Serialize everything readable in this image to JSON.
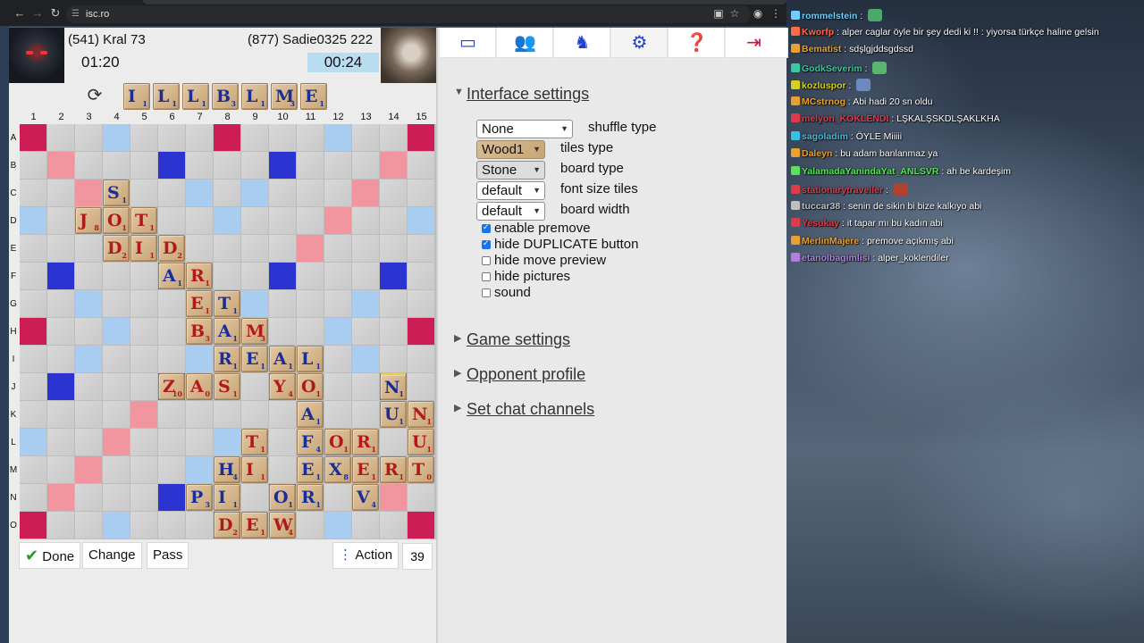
{
  "browser": {
    "url": "isc.ro"
  },
  "players": {
    "me": {
      "name": "(541) Kral 73",
      "time": "01:20"
    },
    "opponent": {
      "name": "(877) Sadie0325 222",
      "time": "00:24"
    }
  },
  "rack": [
    {
      "l": "I",
      "v": "1"
    },
    {
      "l": "L",
      "v": "1"
    },
    {
      "l": "L",
      "v": "1"
    },
    {
      "l": "B",
      "v": "3"
    },
    {
      "l": "L",
      "v": "1"
    },
    {
      "l": "M",
      "v": "3"
    },
    {
      "l": "E",
      "v": "1"
    }
  ],
  "columns": [
    "1",
    "2",
    "3",
    "4",
    "5",
    "6",
    "7",
    "8",
    "9",
    "10",
    "11",
    "12",
    "13",
    "14",
    "15"
  ],
  "rows": [
    "A",
    "B",
    "C",
    "D",
    "E",
    "F",
    "G",
    "H",
    "I",
    "J",
    "K",
    "L",
    "M",
    "N",
    "O"
  ],
  "board_tiles": [
    {
      "r": 2,
      "c": 3,
      "l": "S",
      "v": "1",
      "col": "blue"
    },
    {
      "r": 3,
      "c": 2,
      "l": "J",
      "v": "8",
      "col": "red"
    },
    {
      "r": 3,
      "c": 3,
      "l": "O",
      "v": "1",
      "col": "red"
    },
    {
      "r": 3,
      "c": 4,
      "l": "T",
      "v": "1",
      "col": "red"
    },
    {
      "r": 4,
      "c": 3,
      "l": "D",
      "v": "2",
      "col": "red"
    },
    {
      "r": 4,
      "c": 4,
      "l": "I",
      "v": "1",
      "col": "red"
    },
    {
      "r": 4,
      "c": 5,
      "l": "D",
      "v": "2",
      "col": "red"
    },
    {
      "r": 5,
      "c": 5,
      "l": "A",
      "v": "1",
      "col": "blue"
    },
    {
      "r": 5,
      "c": 6,
      "l": "R",
      "v": "1",
      "col": "red"
    },
    {
      "r": 6,
      "c": 6,
      "l": "E",
      "v": "1",
      "col": "red"
    },
    {
      "r": 6,
      "c": 7,
      "l": "T",
      "v": "1",
      "col": "blue"
    },
    {
      "r": 7,
      "c": 6,
      "l": "B",
      "v": "3",
      "col": "red"
    },
    {
      "r": 7,
      "c": 7,
      "l": "A",
      "v": "1",
      "col": "blue"
    },
    {
      "r": 7,
      "c": 8,
      "l": "M",
      "v": "3",
      "col": "red"
    },
    {
      "r": 8,
      "c": 7,
      "l": "R",
      "v": "1",
      "col": "blue"
    },
    {
      "r": 8,
      "c": 8,
      "l": "E",
      "v": "1",
      "col": "blue"
    },
    {
      "r": 8,
      "c": 9,
      "l": "A",
      "v": "1",
      "col": "blue"
    },
    {
      "r": 8,
      "c": 10,
      "l": "L",
      "v": "1",
      "col": "blue"
    },
    {
      "r": 9,
      "c": 5,
      "l": "Z",
      "v": "10",
      "col": "red"
    },
    {
      "r": 9,
      "c": 6,
      "l": "A",
      "v": "0",
      "col": "red"
    },
    {
      "r": 9,
      "c": 7,
      "l": "S",
      "v": "1",
      "col": "red"
    },
    {
      "r": 9,
      "c": 9,
      "l": "Y",
      "v": "4",
      "col": "red"
    },
    {
      "r": 9,
      "c": 10,
      "l": "O",
      "v": "1",
      "col": "red"
    },
    {
      "r": 9,
      "c": 13,
      "l": "N",
      "v": "1",
      "col": "blue",
      "hl": true
    },
    {
      "r": 10,
      "c": 10,
      "l": "A",
      "v": "1",
      "col": "blue"
    },
    {
      "r": 10,
      "c": 13,
      "l": "U",
      "v": "1",
      "col": "blue"
    },
    {
      "r": 10,
      "c": 14,
      "l": "N",
      "v": "1",
      "col": "red"
    },
    {
      "r": 11,
      "c": 8,
      "l": "T",
      "v": "1",
      "col": "red"
    },
    {
      "r": 11,
      "c": 10,
      "l": "F",
      "v": "4",
      "col": "blue"
    },
    {
      "r": 11,
      "c": 11,
      "l": "O",
      "v": "1",
      "col": "red"
    },
    {
      "r": 11,
      "c": 12,
      "l": "R",
      "v": "1",
      "col": "red"
    },
    {
      "r": 11,
      "c": 14,
      "l": "U",
      "v": "1",
      "col": "red"
    },
    {
      "r": 12,
      "c": 7,
      "l": "H",
      "v": "4",
      "col": "blue"
    },
    {
      "r": 12,
      "c": 8,
      "l": "I",
      "v": "1",
      "col": "red"
    },
    {
      "r": 12,
      "c": 10,
      "l": "E",
      "v": "1",
      "col": "blue"
    },
    {
      "r": 12,
      "c": 11,
      "l": "X",
      "v": "8",
      "col": "blue"
    },
    {
      "r": 12,
      "c": 12,
      "l": "E",
      "v": "1",
      "col": "red"
    },
    {
      "r": 12,
      "c": 13,
      "l": "R",
      "v": "1",
      "col": "red"
    },
    {
      "r": 12,
      "c": 14,
      "l": "T",
      "v": "0",
      "col": "red"
    },
    {
      "r": 13,
      "c": 6,
      "l": "P",
      "v": "3",
      "col": "blue"
    },
    {
      "r": 13,
      "c": 7,
      "l": "I",
      "v": "1",
      "col": "blue"
    },
    {
      "r": 13,
      "c": 9,
      "l": "O",
      "v": "1",
      "col": "blue"
    },
    {
      "r": 13,
      "c": 10,
      "l": "R",
      "v": "1",
      "col": "blue"
    },
    {
      "r": 13,
      "c": 12,
      "l": "V",
      "v": "4",
      "col": "blue"
    },
    {
      "r": 14,
      "c": 7,
      "l": "D",
      "v": "2",
      "col": "red"
    },
    {
      "r": 14,
      "c": 8,
      "l": "E",
      "v": "1",
      "col": "red"
    },
    {
      "r": 14,
      "c": 9,
      "l": "W",
      "v": "4",
      "col": "red"
    }
  ],
  "actions": {
    "done": "Done",
    "change": "Change",
    "pass": "Pass",
    "action": "Action",
    "bag_count": "39"
  },
  "toolbar": [
    "window-icon",
    "players-icon",
    "horse-icon",
    "gear-icon",
    "help-icon",
    "exit-icon"
  ],
  "settings": {
    "interface_title": "Interface settings",
    "shuffle_type": {
      "value": "None",
      "label": "shuffle type"
    },
    "tiles_type": {
      "value": "Wood1",
      "label": "tiles type"
    },
    "board_type": {
      "value": "Stone",
      "label": "board type"
    },
    "font_size_tiles": {
      "value": "default",
      "label": "font size tiles"
    },
    "board_width": {
      "value": "default",
      "label": "board width"
    },
    "checkboxes": [
      {
        "label": "enable premove",
        "checked": true
      },
      {
        "label": "hide DUPLICATE button",
        "checked": true
      },
      {
        "label": "hide move preview",
        "checked": false
      },
      {
        "label": "hide pictures",
        "checked": false
      },
      {
        "label": "sound",
        "checked": false
      }
    ],
    "game_settings": "Game settings",
    "opponent_profile": "Opponent profile",
    "set_chat_channels": "Set chat channels"
  },
  "chat": [
    {
      "nick": "rommelstein",
      "text": "",
      "color": "#6fd0ff",
      "emote": "#4aa86a"
    },
    {
      "nick": "Kworfp",
      "text": "alper caglar öyle bir şey dedi ki !! : yiyorsa türkçe haline gelsin",
      "color": "#ff6a4a"
    },
    {
      "nick": "Bematist",
      "text": "sdşlgjddsgdssd",
      "color": "#e8a030"
    },
    {
      "nick": "GodkSeverim",
      "text": "",
      "color": "#3ac8a0",
      "emote": "#5ab46e"
    },
    {
      "nick": "kozluspor",
      "text": "",
      "color": "#d8d020",
      "emote": "#6a8ac0"
    },
    {
      "nick": "MCstrnog",
      "text": "Abi hadi 20 sn oldu",
      "color": "#e8a030"
    },
    {
      "nick": "melyon_KOKLENDI",
      "text": "LŞKALŞSKDLŞAKLKHA",
      "color": "#e03a4a"
    },
    {
      "nick": "sagoladim",
      "text": "ÖYLE Miiiii",
      "color": "#3ac0e0"
    },
    {
      "nick": "Daleyn",
      "text": "bu adam banlanmaz ya",
      "color": "#e8a030"
    },
    {
      "nick": "YalamadaYanindaYat_ANLSVR",
      "text": "ah be kardeşim",
      "color": "#5ae05a"
    },
    {
      "nick": "stationarytraveller",
      "text": "",
      "color": "#e03a4a",
      "emote": "#b04030"
    },
    {
      "nick": "tuccar38",
      "text": "senin de sikin bi bize kalkıyo abi",
      "color": "#c0c0c0"
    },
    {
      "nick": "Yesukay",
      "text": "it tapar mı bu kadın abi",
      "color": "#e03a4a"
    },
    {
      "nick": "MerlinMajere",
      "text": "premove açıkmış abi",
      "color": "#e8a030"
    },
    {
      "nick": "etanolbagimlisi",
      "text": "alper_koklendiler",
      "color": "#b080e0"
    }
  ]
}
